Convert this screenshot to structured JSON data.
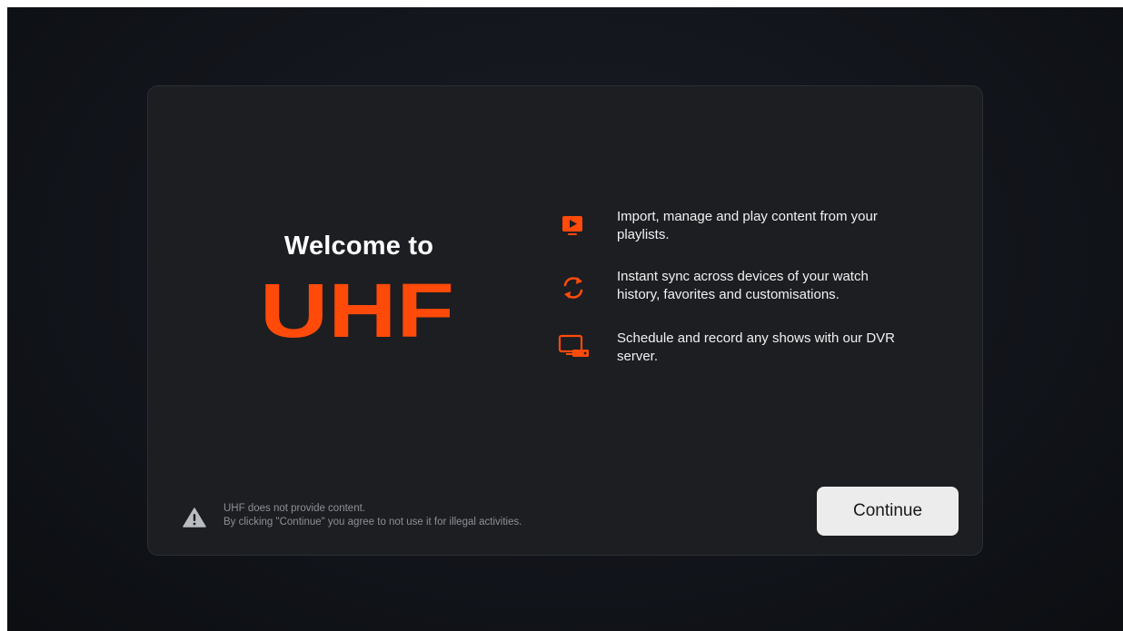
{
  "welcome": {
    "heading": "Welcome to",
    "logo_text": "UHF"
  },
  "features": [
    {
      "icon": "tv-play-icon",
      "line1": "Import, manage and play content from your",
      "line2": "playlists."
    },
    {
      "icon": "sync-icon",
      "line1": "Instant sync across devices of your watch",
      "line2": "history, favorites and customisations."
    },
    {
      "icon": "dvr-icon",
      "line1": "Schedule and record any shows with our DVR",
      "line2": "server."
    }
  ],
  "disclaimer": {
    "icon": "warning-icon",
    "line1": "UHF does not provide content.",
    "line2": "By clicking \"Continue\" you agree to not use it for illegal activities."
  },
  "continue_label": "Continue",
  "colors": {
    "accent": "#ff4a0a",
    "background": "#12151b",
    "card": "#1c1e22",
    "button": "#ececec"
  }
}
